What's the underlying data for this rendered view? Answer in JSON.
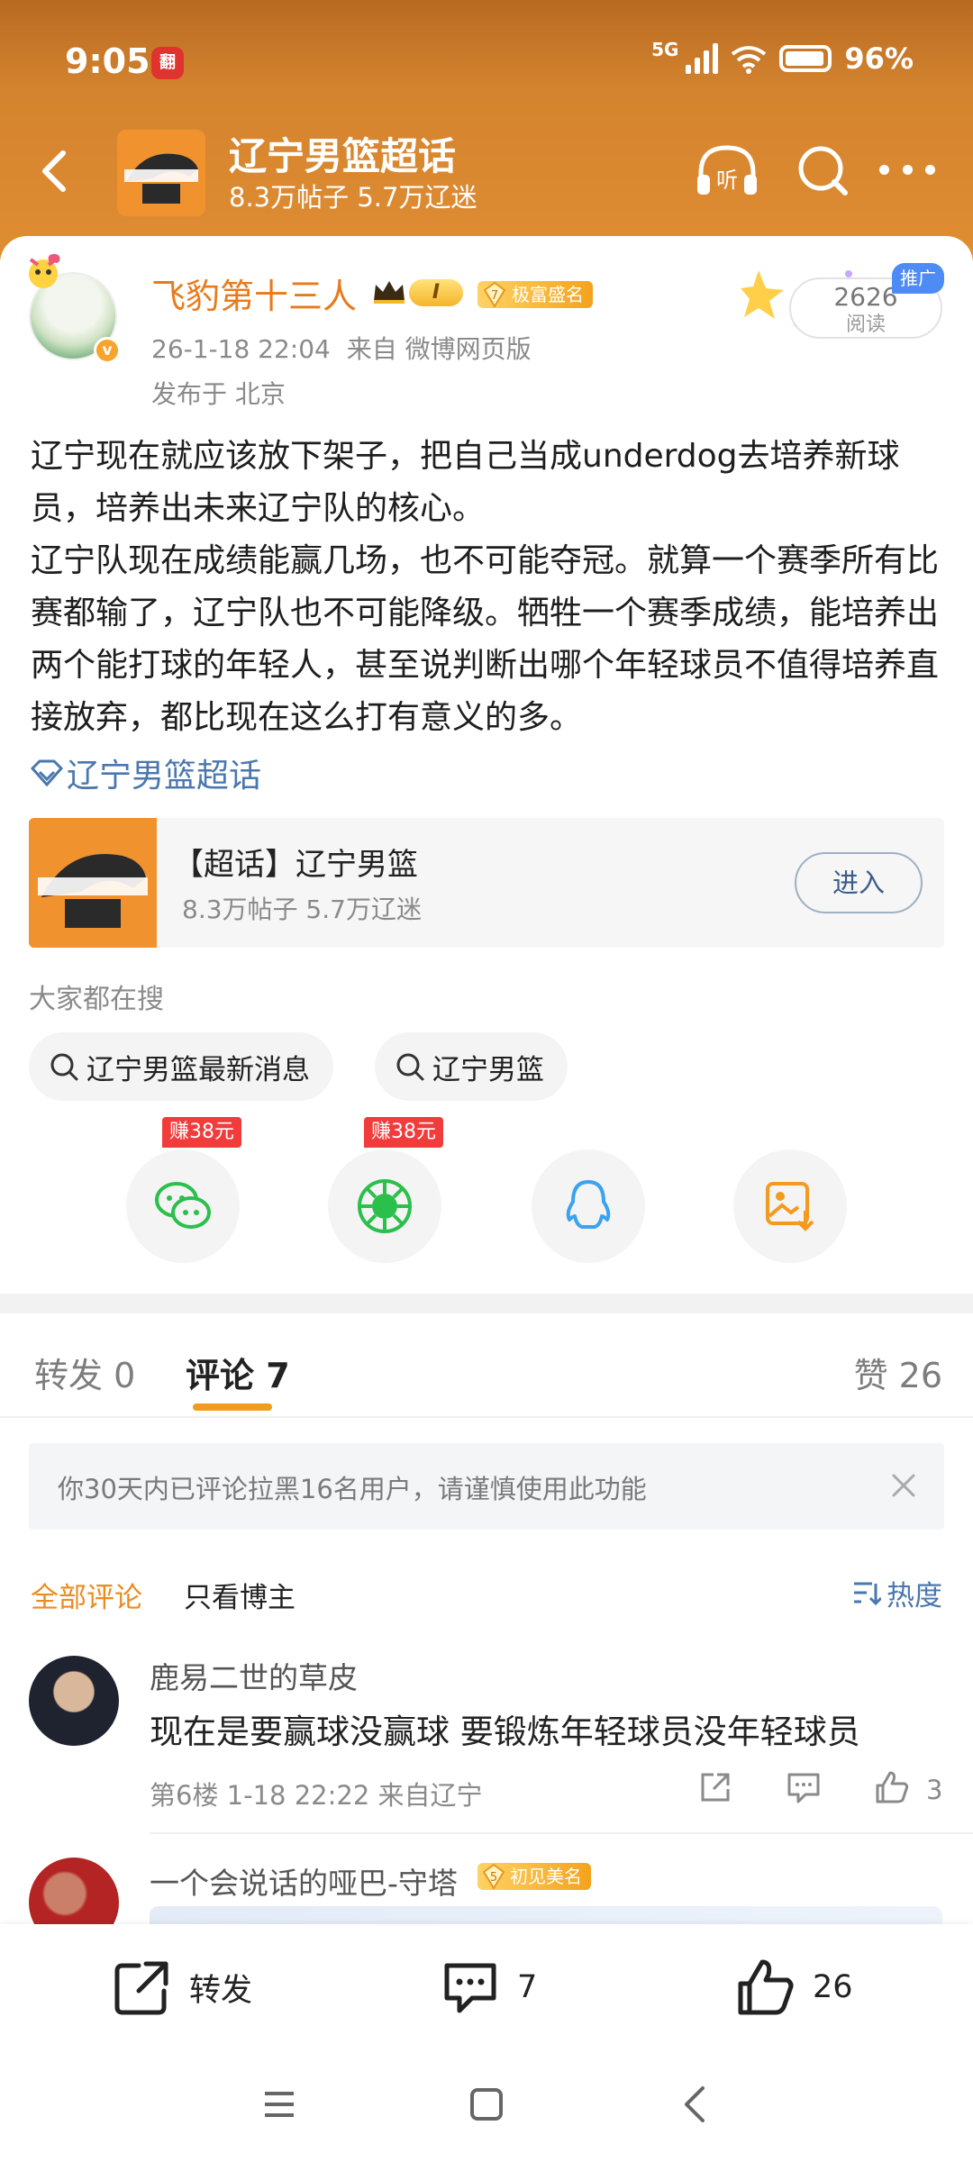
{
  "status_bar": {
    "time": "9:05",
    "app_badge": "翻",
    "network": "5G",
    "battery": "96%"
  },
  "topic_header": {
    "title": "辽宁男篮超话",
    "subtitle": "8.3万帖子 5.7万辽迷"
  },
  "post": {
    "author": "飞豹第十三人",
    "vip_level": "I",
    "fame_level": "7",
    "fame_label": "极富盛名",
    "datetime": "26-1-18 22:04",
    "source": "来自 微博网页版",
    "location": "发布于 北京",
    "read_count": "2626",
    "read_label": "阅读",
    "promo_tag": "推广",
    "paragraphs": [
      "辽宁现在就应该放下架子，把自己当成underdog去培养新球员，培养出未来辽宁队的核心。",
      "辽宁队现在成绩能赢几场，也不可能夺冠。就算一个赛季所有比赛都输了，辽宁队也不可能降级。牺牲一个赛季成绩，能培养出两个能打球的年轻人，甚至说判断出哪个年轻球员不值得培养直接放弃，都比现在这么打有意义的多。"
    ],
    "topic_link": "辽宁男篮超话"
  },
  "topic_card": {
    "title": "【超话】辽宁男篮",
    "subtitle": "8.3万帖子 5.7万辽迷",
    "enter_label": "进入"
  },
  "search": {
    "hint": "大家都在搜",
    "chips": [
      "辽宁男篮最新消息",
      "辽宁男篮"
    ]
  },
  "share": {
    "items": [
      {
        "icon": "wechat-icon",
        "reward": "赚38元",
        "color": "#2bbf4b"
      },
      {
        "icon": "moments-icon",
        "reward": "赚38元",
        "color": "#2bbf4b"
      },
      {
        "icon": "qq-icon",
        "reward": "",
        "color": "#3aa3f0"
      },
      {
        "icon": "save-image-icon",
        "reward": "",
        "color": "#f39a1f"
      }
    ]
  },
  "tabs": {
    "repost": "转发 0",
    "comment": "评论 7",
    "like": "赞 26"
  },
  "notice": {
    "text": "你30天内已评论拉黑16名用户，请谨慎使用此功能"
  },
  "filters": {
    "all": "全部评论",
    "author_only": "只看博主",
    "sort": "热度"
  },
  "comments": [
    {
      "user": "鹿易二世的草皮",
      "text": "现在是要赢球没赢球 要锻炼年轻球员没年轻球员",
      "meta": "第6楼 1-18 22:22 来自辽宁",
      "likes": "3"
    },
    {
      "user": "一个会说话的哑巴-守塔",
      "fame_level": "5",
      "fame_label": "初见美名"
    }
  ],
  "bottom_bar": {
    "repost": "转发",
    "comment_count": "7",
    "like_count": "26"
  },
  "colors": {
    "header": "#d4842e",
    "accent": "#ec8a1e",
    "link": "#4a77ae"
  }
}
